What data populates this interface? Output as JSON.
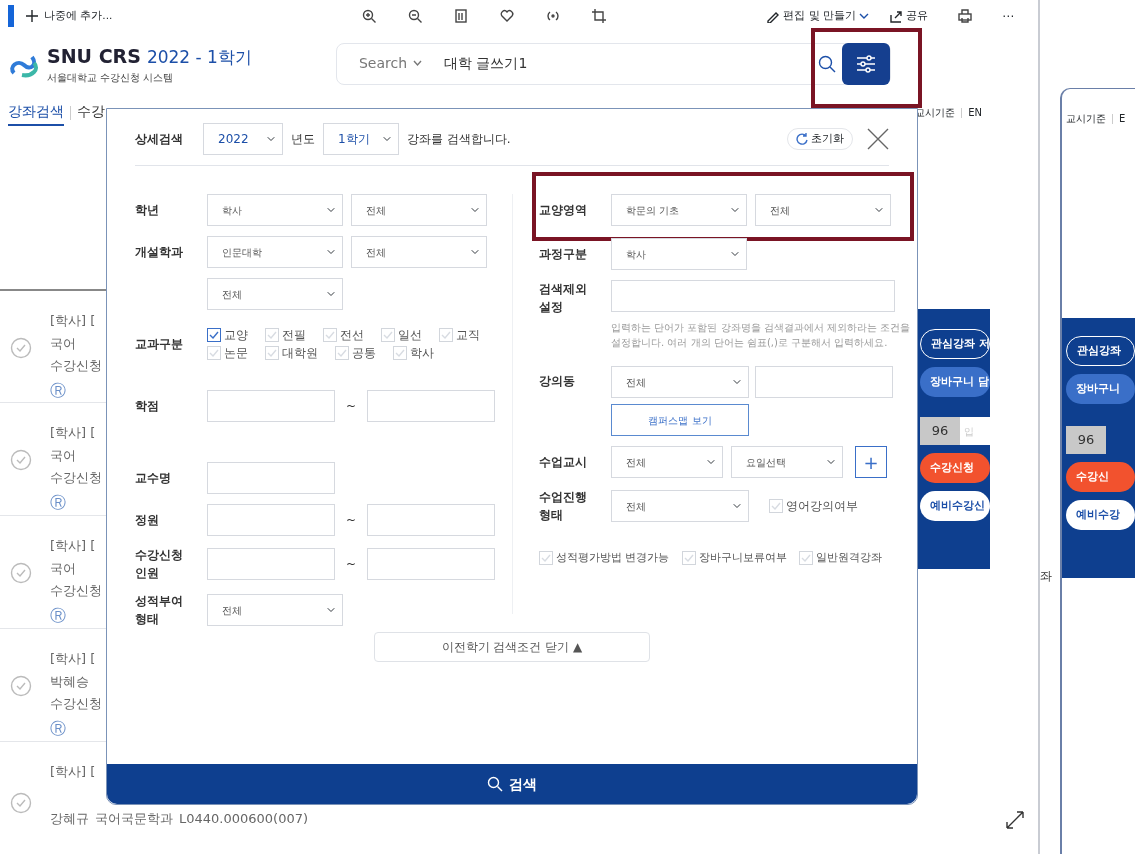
{
  "toolbar": {
    "add_label": "나중에 추가...",
    "edit_label": "편집 및 만들기",
    "share_label": "공유",
    "more": "⋯"
  },
  "header": {
    "brand": "SNU CRS",
    "term": "2022 - 1학기",
    "subtitle": "서울대학교 수강신청 시스템",
    "search_scope": "Search",
    "search_value": "대학 글쓰기1",
    "filter_highlighted": true
  },
  "nav_tabs": [
    {
      "label": "강좌검색",
      "selected": true
    },
    {
      "label": "수강",
      "selected": false
    }
  ],
  "nav_right": [
    "교시기준",
    "EN"
  ],
  "courses": [
    {
      "line1": "[학사] [",
      "line2": "국어",
      "line3": "수강신청",
      "badge": "Ⓡ"
    },
    {
      "line1": "[학사] [",
      "line2": "국어",
      "line3": "수강신청",
      "badge": "Ⓡ"
    },
    {
      "line1": "[학사] [",
      "line2": "국어",
      "line3": "수강신청",
      "badge": "Ⓡ"
    },
    {
      "line1": "[학사] [",
      "line2": "박혜승",
      "line3": "수강신청",
      "badge": "Ⓡ"
    },
    {
      "line1": "[학사] [",
      "line2": "강혜규",
      "line3": "국어국문학과",
      "line4": "L0440.000600(007)"
    }
  ],
  "side_panel": {
    "buttons": [
      "관심강좌 저",
      "장바구니 담"
    ],
    "count": "96",
    "count_unit": "입",
    "apply": "수강신청",
    "pre_apply": "예비수강신"
  },
  "second_window": {
    "nav": [
      "교시기준",
      "E"
    ],
    "stray_text": "좌",
    "buttons": [
      "관심강좌",
      "장바구니"
    ],
    "count": "96",
    "apply": "수강신",
    "pre_apply": "예비수강"
  },
  "modal": {
    "title": "상세검색",
    "year": "2022",
    "year_unit": "년도",
    "term": "1학기",
    "suffix": "강좌를 검색합니다.",
    "reset": "초기화",
    "left_rows": [
      {
        "kind": "selects",
        "label": "학년",
        "values": [
          "학사",
          "전체"
        ]
      },
      {
        "kind": "selects",
        "label": "개설학과",
        "values": [
          "인문대학",
          "전체"
        ]
      },
      {
        "kind": "selects",
        "values": [
          "전체"
        ]
      },
      {
        "kind": "checks",
        "label": "교과구분",
        "options": [
          {
            "label": "교양",
            "checked": true
          },
          {
            "label": "전필",
            "checked": false
          },
          {
            "label": "전선",
            "checked": false
          },
          {
            "label": "일선",
            "checked": false
          },
          {
            "label": "교직",
            "checked": false
          },
          {
            "label": "논문",
            "checked": false
          },
          {
            "label": "대학원",
            "checked": false
          },
          {
            "label": "공통",
            "checked": false
          },
          {
            "label": "학사",
            "checked": false
          }
        ]
      },
      {
        "kind": "range",
        "label": "학점",
        "separator": "~"
      },
      {
        "kind": "input",
        "label": "교수명"
      },
      {
        "kind": "range",
        "label": "정원",
        "separator": "~"
      },
      {
        "kind": "range",
        "label": "수강신청 인원",
        "separator": "~"
      },
      {
        "kind": "selects",
        "label": "성적부여 형태",
        "values": [
          "전체"
        ]
      }
    ],
    "right_rows": [
      {
        "kind": "selects",
        "label": "교양영역",
        "values": [
          "학문의 기초",
          "전체"
        ],
        "highlighted": true
      },
      {
        "kind": "selects",
        "label": "과정구분",
        "values": [
          "학사"
        ]
      },
      {
        "kind": "wide_input",
        "label": "검색제외 설정",
        "help": "입력하는 단어가 포함된 강좌명을 검색결과에서 제외하라는 조건을 설정합니다. 여러 개의 단어는 쉼표(,)로 구분해서 입력하세요."
      },
      {
        "kind": "select_input",
        "label": "강의동",
        "values": [
          "전체"
        ],
        "button": "캠퍼스맵 보기"
      },
      {
        "kind": "selects",
        "label": "수업교시",
        "values": [
          "전체",
          "요일선택"
        ],
        "add": "+"
      },
      {
        "kind": "select_check",
        "label": "수업진행 형태",
        "values": [
          "전체"
        ],
        "check": {
          "label": "영어강의여부",
          "checked": false
        }
      },
      {
        "kind": "checks_row",
        "options": [
          {
            "label": "성적평가방법 변경가능",
            "checked": false
          },
          {
            "label": "장바구니보류여부",
            "checked": false
          },
          {
            "label": "일반원격강좌",
            "checked": false
          }
        ]
      }
    ],
    "collapse_button": "이전학기 검색조건 닫기 ▲",
    "search_button": "검색"
  }
}
